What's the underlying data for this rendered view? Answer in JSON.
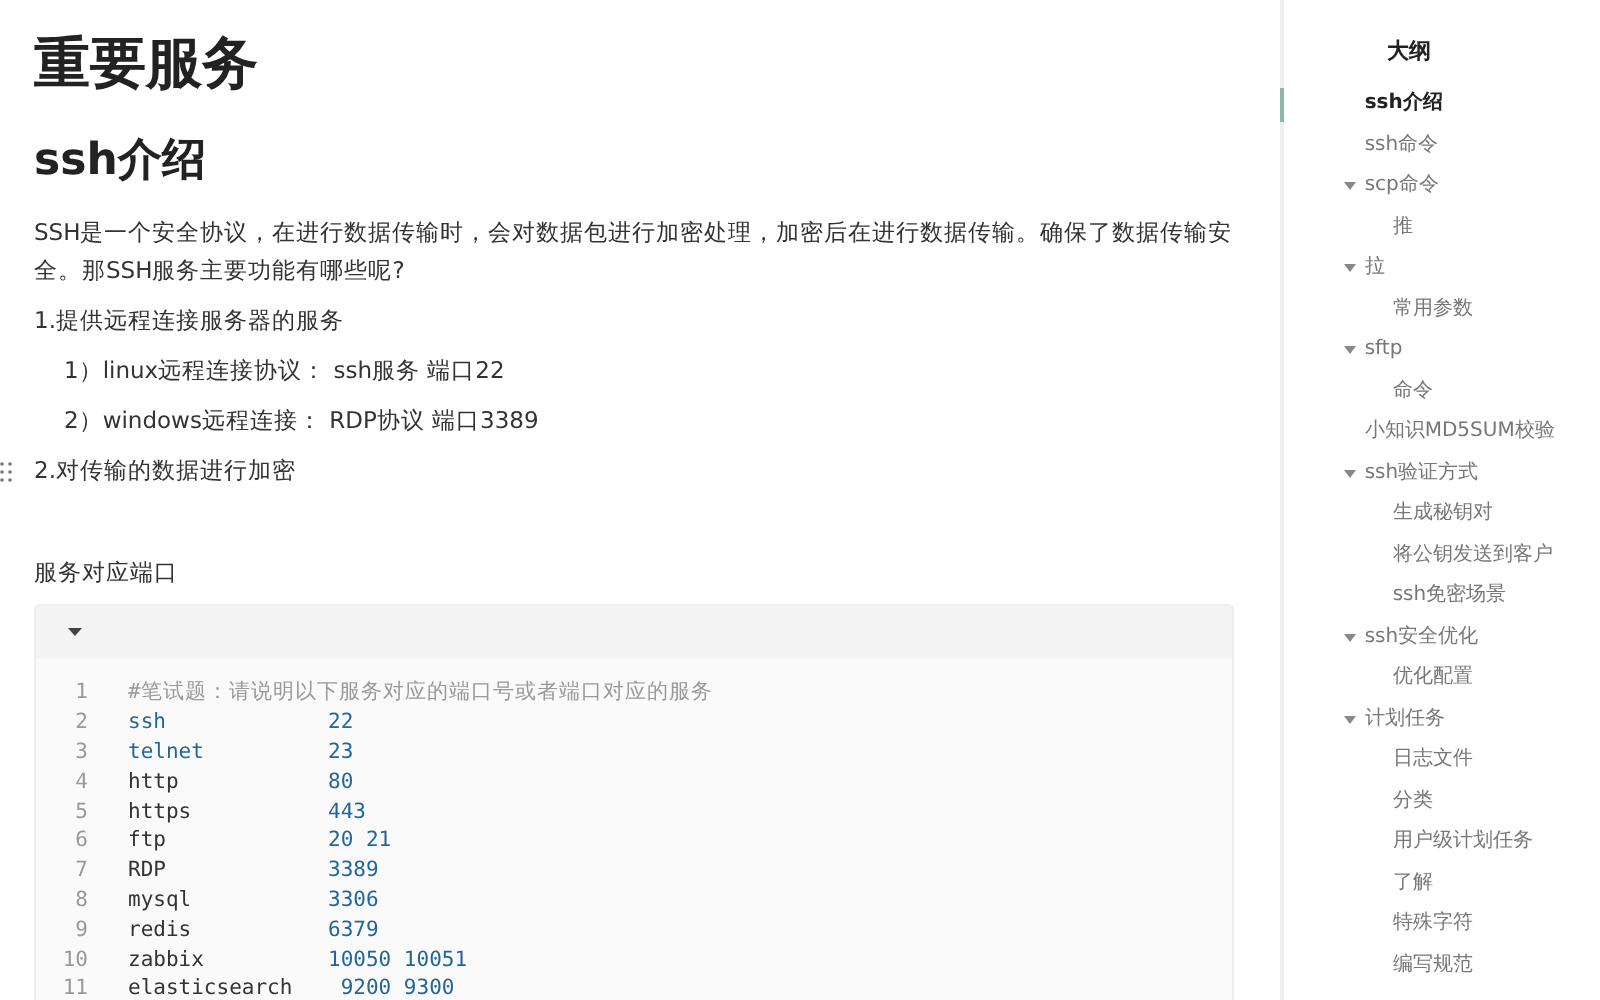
{
  "document": {
    "title": "重要服务",
    "heading": "ssh介绍",
    "paragraphs": [
      {
        "kind": "body",
        "text": "SSH是一个安全协议，在进行数据传输时，会对数据包进行加密处理，加密后在进行数据传输。确保了数据传输安全。那SSH服务主要功能有哪些呢?"
      },
      {
        "kind": "item",
        "text": "1.提供远程连接服务器的服务"
      },
      {
        "kind": "subitem",
        "text": "1）linux远程连接协议：  ssh服务  端口22"
      },
      {
        "kind": "subitem",
        "text": "2）windows远程连接：    RDP协议  端口3389"
      },
      {
        "kind": "item",
        "text": "2.对传输的数据进行加密",
        "handle": true
      }
    ],
    "code_caption": "服务对应端口",
    "code": {
      "expanded": true,
      "lines": [
        {
          "number": "1",
          "kind": "comment",
          "name": "#笔试题：请说明以下服务对应的端口号或者端口对应的服务"
        },
        {
          "number": "2",
          "kind": "keyword",
          "name": "ssh",
          "port": "22"
        },
        {
          "number": "3",
          "kind": "keyword",
          "name": "telnet",
          "port": "23"
        },
        {
          "number": "4",
          "kind": "plain",
          "name": "http",
          "port": "80"
        },
        {
          "number": "5",
          "kind": "plain",
          "name": "https",
          "port": "443"
        },
        {
          "number": "6",
          "kind": "plain",
          "name": "ftp",
          "port": "20 21"
        },
        {
          "number": "7",
          "kind": "plain",
          "name": "RDP",
          "port": "3389"
        },
        {
          "number": "8",
          "kind": "plain",
          "name": "mysql",
          "port": "3306"
        },
        {
          "number": "9",
          "kind": "plain",
          "name": "redis",
          "port": "6379"
        },
        {
          "number": "10",
          "kind": "plain",
          "name": "zabbix",
          "port": "10050 10051"
        },
        {
          "number": "11",
          "kind": "plain",
          "name": "elasticsearch",
          "port": " 9200 9300"
        }
      ]
    }
  },
  "outline": {
    "title": "大纲",
    "items": [
      {
        "label": "ssh介绍",
        "selected": true
      },
      {
        "label": "ssh命令",
        "selected": false
      },
      {
        "label": "scp命令",
        "selected": false,
        "expanded": true,
        "children": [
          {
            "label": "推",
            "selected": false
          }
        ]
      },
      {
        "label": "拉",
        "selected": false,
        "expanded": true,
        "children": [
          {
            "label": "常用参数",
            "selected": false
          }
        ]
      },
      {
        "label": "sftp",
        "selected": false,
        "expanded": true,
        "children": [
          {
            "label": "命令",
            "selected": false
          }
        ]
      },
      {
        "label": "小知识MD5SUM校验",
        "selected": false
      },
      {
        "label": "ssh验证方式",
        "selected": false,
        "expanded": true,
        "children": [
          {
            "label": "生成秘钥对",
            "selected": false
          },
          {
            "label": "将公钥发送到客户",
            "selected": false
          },
          {
            "label": "ssh免密场景",
            "selected": false
          }
        ]
      },
      {
        "label": "ssh安全优化",
        "selected": false,
        "expanded": true,
        "children": [
          {
            "label": "优化配置",
            "selected": false
          }
        ]
      },
      {
        "label": "计划任务",
        "selected": false,
        "expanded": true,
        "children": [
          {
            "label": "日志文件",
            "selected": false
          },
          {
            "label": "分类",
            "selected": false
          },
          {
            "label": "用户级计划任务",
            "selected": false
          },
          {
            "label": "了解",
            "selected": false
          },
          {
            "label": "特殊字符",
            "selected": false
          },
          {
            "label": "编写规范",
            "selected": false
          }
        ]
      }
    ]
  }
}
